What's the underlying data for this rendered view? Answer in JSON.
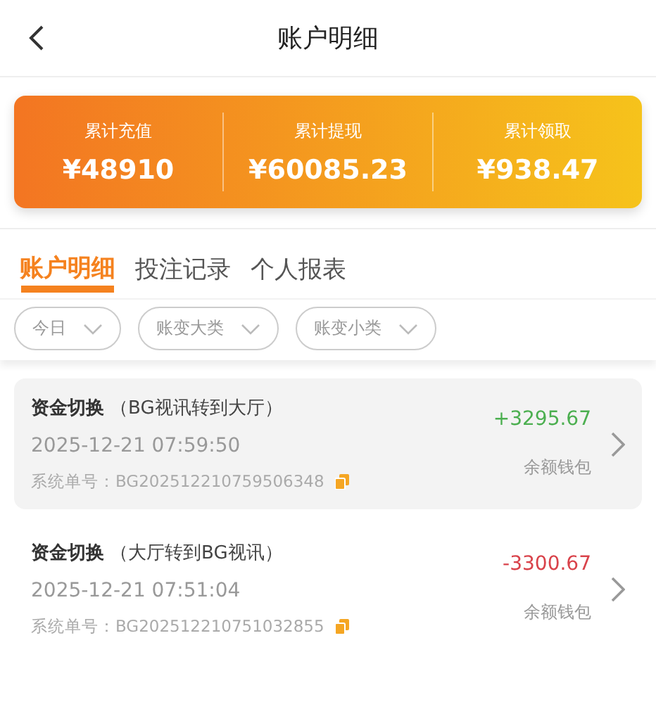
{
  "header": {
    "title": "账户明细"
  },
  "summary": [
    {
      "label": "累计充值",
      "value": "¥48910"
    },
    {
      "label": "累计提现",
      "value": "¥60085.23"
    },
    {
      "label": "累计领取",
      "value": "¥938.47"
    }
  ],
  "tabs": [
    {
      "label": "账户明细",
      "selected": true
    },
    {
      "label": "投注记录",
      "selected": false
    },
    {
      "label": "个人报表",
      "selected": false
    }
  ],
  "filters": [
    {
      "label": "今日"
    },
    {
      "label": "账变大类"
    },
    {
      "label": "账变小类"
    }
  ],
  "records": [
    {
      "title": "资金切换",
      "detail": "（BG视讯转到大厅）",
      "time": "2025-12-21 07:59:50",
      "order": "系统单号：BG202512210759506348",
      "amount": "+3295.67",
      "kind": "credit",
      "wallet": "余额钱包",
      "selected": true
    },
    {
      "title": "资金切换",
      "detail": "（大厅转到BG视讯）",
      "time": "2025-12-21 07:51:04",
      "order": "系统单号：BG202512210751032855",
      "amount": "-3300.67",
      "kind": "debit",
      "wallet": "余额钱包",
      "selected": false
    }
  ]
}
